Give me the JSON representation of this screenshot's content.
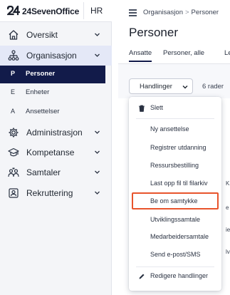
{
  "app": {
    "brand": "24SevenOffice",
    "tenant": "HR"
  },
  "sidebar": {
    "items": [
      {
        "label": "Oversikt",
        "icon": "home-icon"
      },
      {
        "label": "Organisasjon",
        "icon": "org-chart-icon"
      },
      {
        "label": "Administrasjon",
        "icon": "gear-icon"
      },
      {
        "label": "Kompetanse",
        "icon": "graduation-cap-icon"
      },
      {
        "label": "Samtaler",
        "icon": "people-talk-icon"
      },
      {
        "label": "Rekruttering",
        "icon": "id-card-icon"
      }
    ],
    "subitems": [
      {
        "letter": "P",
        "label": "Personer"
      },
      {
        "letter": "E",
        "label": "Enheter"
      },
      {
        "letter": "A",
        "label": "Ansettelser"
      }
    ]
  },
  "breadcrumb": {
    "parent": "Organisasjon",
    "separator": ">",
    "current": "Personer"
  },
  "page": {
    "title": "Personer"
  },
  "tabs": [
    "Ansatte",
    "Personer, alle",
    "Lede"
  ],
  "toolbar": {
    "actions_label": "Handlinger",
    "rows_count": "6 rader"
  },
  "table_fragments": [
    "KS",
    "e",
    "ie",
    "lv"
  ],
  "dropdown": {
    "items": [
      {
        "label": "Slett",
        "icon": "trash-icon"
      },
      {
        "label": "Ny ansettelse"
      },
      {
        "label": "Registrer utdanning"
      },
      {
        "label": "Ressursbestilling"
      },
      {
        "label": "Last opp fil til filarkiv"
      },
      {
        "label": "Be om samtykke",
        "highlighted": true
      },
      {
        "label": "Utviklingssamtale"
      },
      {
        "label": "Medarbeidersamtale"
      },
      {
        "label": "Send e-post/SMS"
      },
      {
        "label": "Redigere handlinger",
        "icon": "pencil-icon"
      }
    ]
  },
  "colors": {
    "selected_nav": "#121b4a",
    "highlight_border": "#e8542c",
    "active_parent_bg": "#e4e8f7"
  }
}
